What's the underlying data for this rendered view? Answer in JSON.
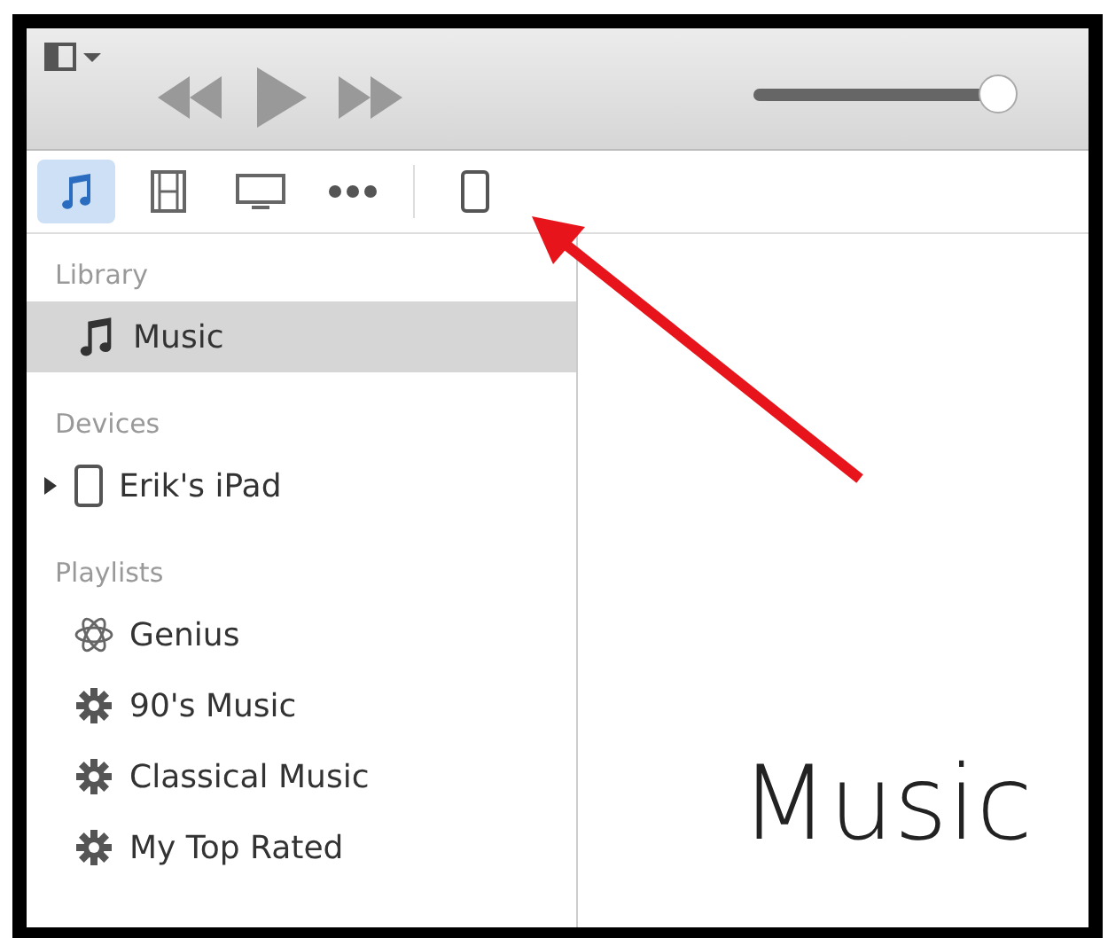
{
  "player": {
    "volume": {
      "level": 1
    }
  },
  "media_tabs": [
    {
      "kind": "music",
      "selected": true
    },
    {
      "kind": "movies",
      "selected": false
    },
    {
      "kind": "tv",
      "selected": false
    },
    {
      "kind": "more",
      "selected": false
    },
    {
      "kind": "device",
      "selected": false
    }
  ],
  "sidebar": {
    "sections": [
      {
        "title": "Library",
        "items": [
          {
            "kind": "music",
            "label": "Music",
            "selected": true
          }
        ]
      },
      {
        "title": "Devices",
        "items": [
          {
            "kind": "device",
            "label": "Erik's iPad",
            "selected": false,
            "expanded": false
          }
        ]
      },
      {
        "title": "Playlists",
        "items": [
          {
            "kind": "genius",
            "label": "Genius",
            "selected": false
          },
          {
            "kind": "smart",
            "label": "90's Music",
            "selected": false
          },
          {
            "kind": "smart",
            "label": "Classical Music",
            "selected": false
          },
          {
            "kind": "smart",
            "label": "My Top Rated",
            "selected": false
          }
        ]
      }
    ]
  },
  "main": {
    "title": "Music"
  }
}
